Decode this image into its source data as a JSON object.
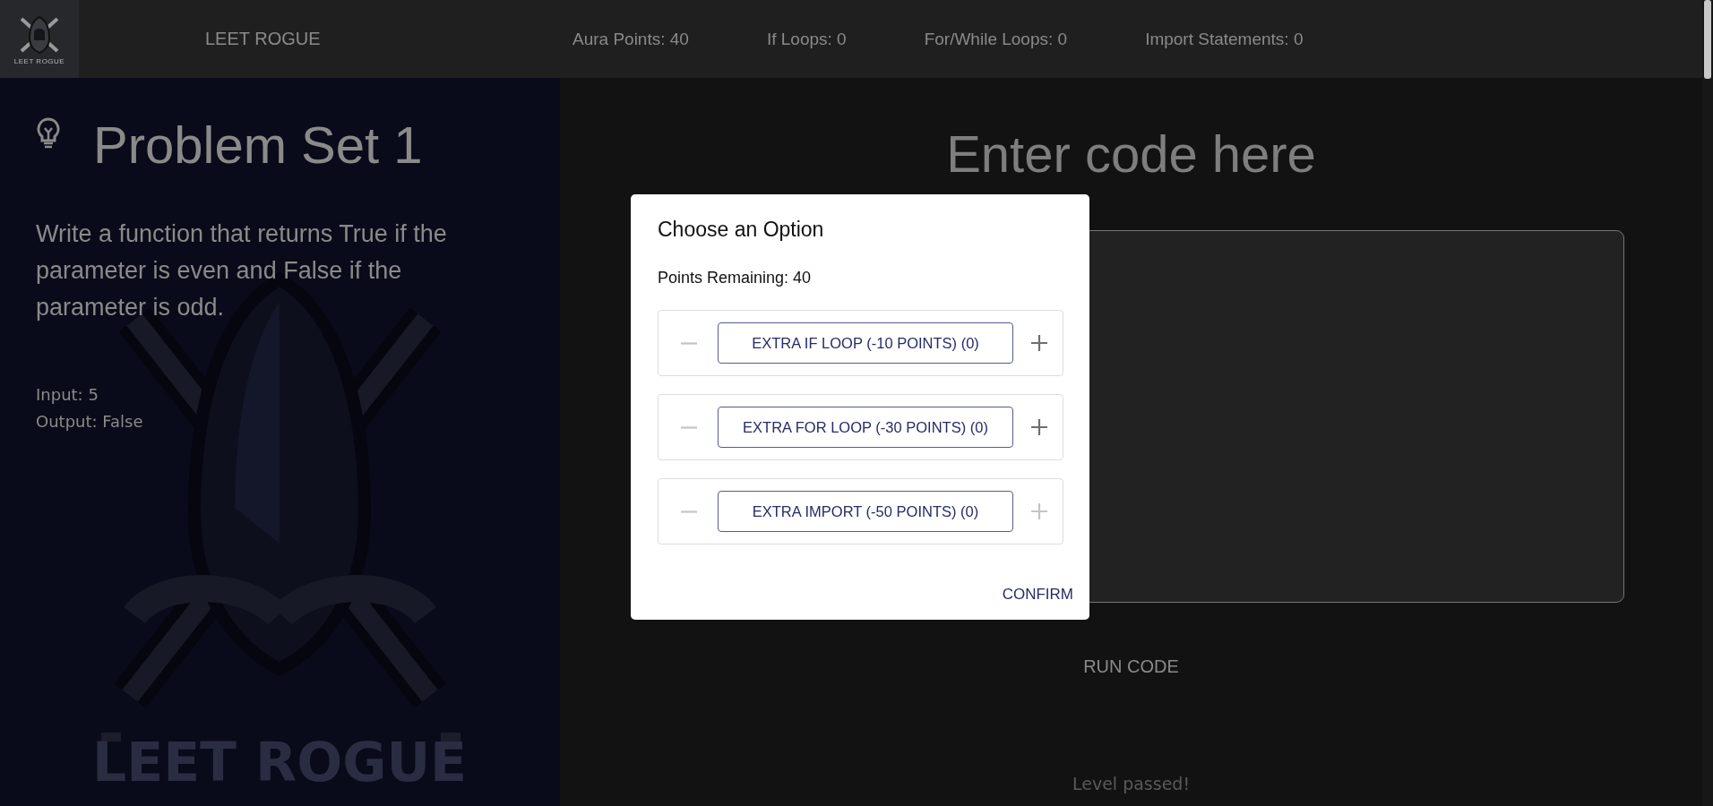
{
  "header": {
    "logo_text": "LEET ROGUE",
    "title": "LEET ROGUE",
    "stats": [
      "Aura Points: 40",
      "If Loops: 0",
      "For/While Loops: 0",
      "Import Statements: 0"
    ]
  },
  "problem": {
    "title": "Problem Set 1",
    "description": "Write a function that returns True if the parameter is even and False if the parameter is odd.",
    "examples": [
      "Input: 5",
      "Output: False"
    ],
    "background_logo_text": "LEET ROGUE"
  },
  "editor": {
    "heading": "Enter code here",
    "run_button": "RUN CODE",
    "status": "Level passed!"
  },
  "dialog": {
    "title": "Choose an Option",
    "points": "Points Remaining: 40",
    "options": [
      {
        "label": "EXTRA IF LOOP (-10 POINTS) (0)",
        "minus_disabled": true,
        "plus_disabled": false
      },
      {
        "label": "EXTRA FOR LOOP (-30 POINTS) (0)",
        "minus_disabled": true,
        "plus_disabled": false
      },
      {
        "label": "EXTRA IMPORT (-50 POINTS) (0)",
        "minus_disabled": true,
        "plus_disabled": true
      }
    ],
    "confirm": "CONFIRM"
  }
}
